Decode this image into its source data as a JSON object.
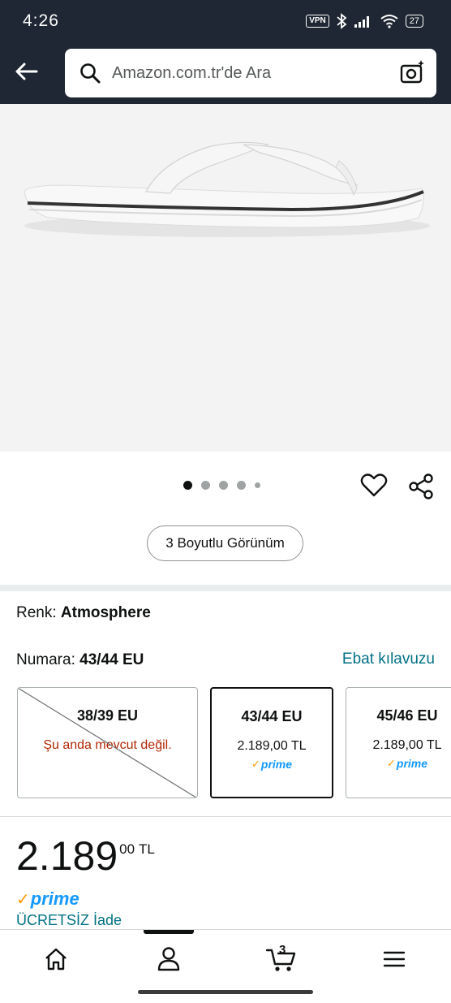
{
  "status_bar": {
    "time": "4:26",
    "vpn_label": "VPN",
    "battery": "27"
  },
  "search": {
    "placeholder": "Amazon.com.tr'de Ara"
  },
  "image_carousel": {
    "total_dots": 5,
    "active_index": 0
  },
  "view_3d_label": "3 Boyutlu Görünüm",
  "color": {
    "label": "Renk: ",
    "value": "Atmosphere"
  },
  "size": {
    "label": "Numara: ",
    "value": "43/44 EU",
    "guide_label": "Ebat kılavuzu",
    "options": [
      {
        "label": "38/39 EU",
        "status": "Şu anda mevcut değil.",
        "available": false
      },
      {
        "label": "43/44 EU",
        "price": "2.189,00 TL",
        "prime": "prime",
        "selected": true
      },
      {
        "label": "45/46 EU",
        "price": "2.189,00 TL",
        "prime": "prime"
      }
    ]
  },
  "price": {
    "whole": "2.189",
    "fraction": "00",
    "currency": "TL"
  },
  "prime": {
    "label": "prime",
    "free_return": "ÜCRETSİZ İade"
  },
  "bottom_nav": {
    "cart_count": "3",
    "items": [
      "home-icon",
      "account-icon",
      "cart-icon",
      "menu-icon"
    ],
    "active_index": 1
  },
  "colors": {
    "header_bg": "#1e2733",
    "link": "#007185",
    "prime_blue": "#1399FF",
    "prime_check": "#FF9900",
    "unavailable": "#B12704"
  }
}
